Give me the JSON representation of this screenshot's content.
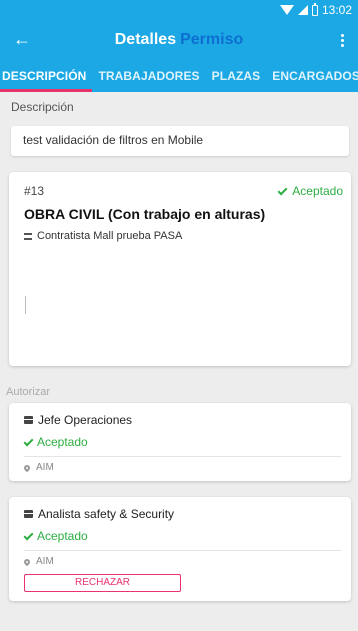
{
  "status_bar": {
    "time": "13:02"
  },
  "appbar": {
    "title_part1": "Detalles",
    "title_part2": "Permiso",
    "back_icon": "arrow-left-icon",
    "menu_icon": "more-vert-icon"
  },
  "tabs": [
    {
      "label": "DESCRIPCIÓN"
    },
    {
      "label": "TRABAJADORES"
    },
    {
      "label": "PLAZAS"
    },
    {
      "label": "ENCARGADOS"
    }
  ],
  "description": {
    "label": "Descripción",
    "value": "test validación de filtros en Mobile"
  },
  "permit": {
    "number": "#13",
    "status": "Aceptado",
    "title": "OBRA CIVIL (Con trabajo en alturas)",
    "contractor": "Contratista Mall prueba PASA"
  },
  "authorize": {
    "label": "Autorizar",
    "items": [
      {
        "name": "Jefe Operaciones",
        "status": "Aceptado",
        "location": "AIM"
      },
      {
        "name": "Analista safety & Security",
        "status": "Aceptado",
        "location": "AIM",
        "reject_label": "RECHAZAR"
      }
    ]
  },
  "colors": {
    "primary": "#1ca8e4",
    "accent": "#e8336d",
    "success": "#2eae43",
    "title_accent": "#0c6fd1"
  }
}
